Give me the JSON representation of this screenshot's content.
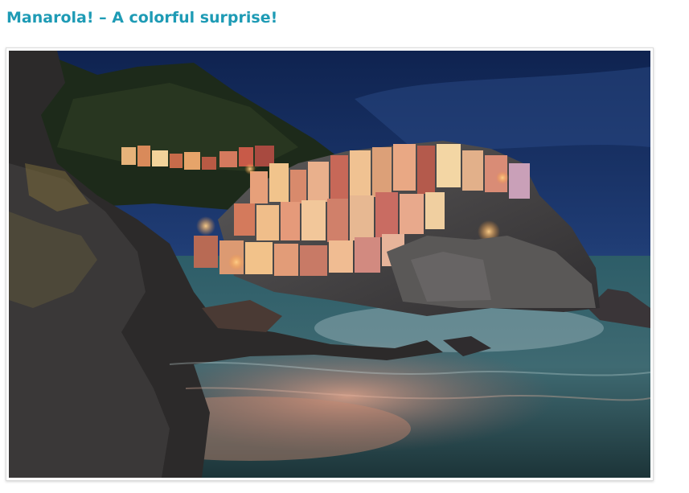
{
  "post": {
    "title": "Manarola! – A colorful surprise!",
    "image_subject": "Manarola village at dusk"
  },
  "colors": {
    "title": "#1e9bb5",
    "sky": "#1f3c74",
    "sea": "#3a6f7a"
  }
}
